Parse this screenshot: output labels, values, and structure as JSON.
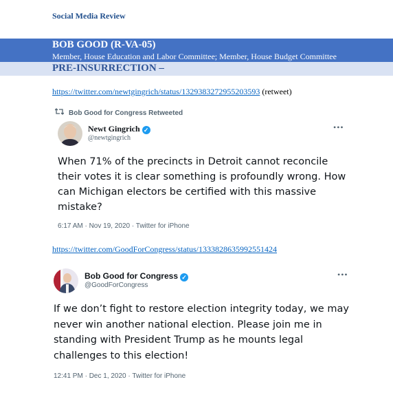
{
  "document": {
    "header": "Social Media Review",
    "member_name": "BOB GOOD (R-VA-05)",
    "member_roles": "Member, House Education and Labor Committee; Member, House Budget Committee",
    "section_title": "PRE-INSURRECTION –"
  },
  "entries": [
    {
      "url": "https://twitter.com/newtgingrich/status/1329383272955203593",
      "note": " (retweet)",
      "retweet_label": "Bob Good for Congress Retweeted",
      "display_name": "Newt Gingrich",
      "handle": "@newtgingrich",
      "more": "•••",
      "text": "When 71% of the precincts in Detroit cannot reconcile their votes it is clear something is profoundly wrong. How can Michigan electors be certified with this massive mistake?",
      "meta": "6:17 AM · Nov 19, 2020 · Twitter for iPhone"
    },
    {
      "url": "https://twitter.com/GoodForCongress/status/1333828635992551424",
      "note": "",
      "display_name": "Bob Good for Congress",
      "handle": "@GoodForCongress",
      "more": "•••",
      "text": "If we don’t fight to restore election integrity today, we may never win another national election.  Please join me in standing with President Trump as he mounts legal challenges to this election!",
      "meta": "12:41 PM · Dec 1, 2020 · Twitter for iPhone"
    }
  ],
  "colors": {
    "band": "#4472c4",
    "band2": "#d9e2f3",
    "link": "#0563c1",
    "verified": "#1d9bf0"
  }
}
